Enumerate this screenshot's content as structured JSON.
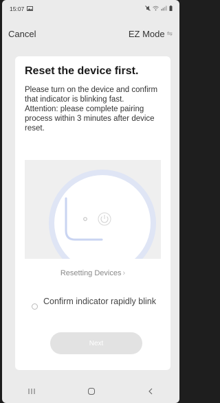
{
  "status_bar": {
    "time": "15:07",
    "notification_icon": "image-icon",
    "right_icons": [
      "mute-icon",
      "wifi-icon",
      "signal-icon",
      "battery-icon"
    ]
  },
  "top_nav": {
    "cancel_label": "Cancel",
    "mode_label": "EZ Mode",
    "mode_icon": "switch-arrows-icon"
  },
  "card": {
    "title": "Reset the device first.",
    "desc_line1": "Please turn on the device and confirm that indicator is blinking fast.",
    "desc_line2": "Attention: please complete pairing process within 3 minutes after device reset.",
    "reset_link": "Resetting Devices",
    "confirm_label": "Confirm indicator rapidly blink",
    "confirm_checked": false,
    "next_label": "Next"
  },
  "nav_bar": {
    "recent_glyph": "|||",
    "home_glyph": "O",
    "back_glyph": "<"
  },
  "colors": {
    "background": "#ebebeb",
    "card": "#ffffff",
    "button_disabled": "#e2e2e2",
    "accent_blue": "#c9d4f2"
  }
}
